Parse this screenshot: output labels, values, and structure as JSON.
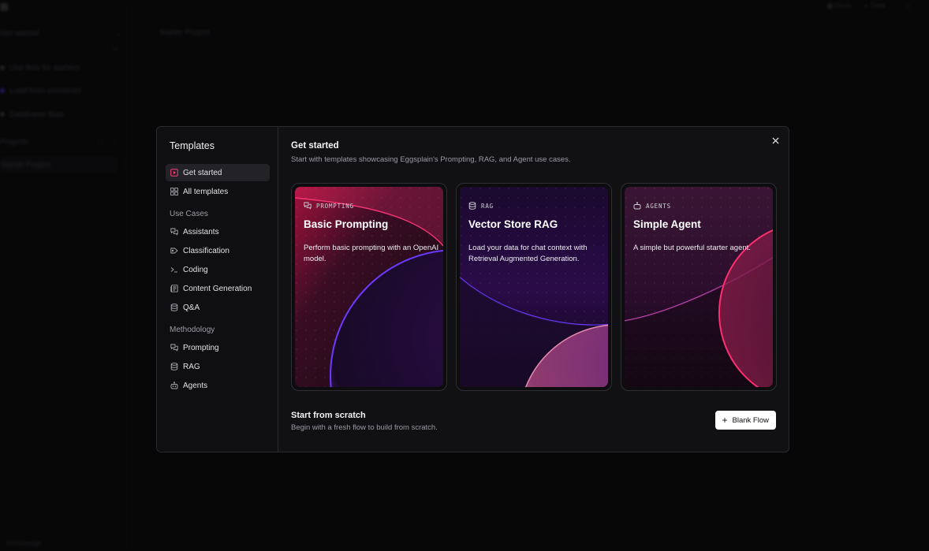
{
  "background": {
    "sidebar_section_1": "Get started",
    "sidebar_items": [
      "Use flow for starters",
      "Load from connector",
      "Dataframe Bias"
    ],
    "sidebar_section_2": "Projects",
    "sidebar_folder": "Starter Project",
    "main_title": "Starter Project",
    "top_right": [
      "Docs",
      "Dark"
    ],
    "bottom_left": "Knowledge"
  },
  "modal": {
    "nav_title": "Templates",
    "nav_primary": [
      {
        "label": "Get started",
        "icon": "play-square-icon",
        "active": true
      },
      {
        "label": "All templates",
        "icon": "layout-grid-icon",
        "active": false
      }
    ],
    "groups": [
      {
        "title": "Use Cases",
        "items": [
          {
            "label": "Assistants",
            "icon": "chat-bubbles-icon"
          },
          {
            "label": "Classification",
            "icon": "tag-icon"
          },
          {
            "label": "Coding",
            "icon": "terminal-icon"
          },
          {
            "label": "Content Generation",
            "icon": "newspaper-icon"
          },
          {
            "label": "Q&A",
            "icon": "database-icon"
          }
        ]
      },
      {
        "title": "Methodology",
        "items": [
          {
            "label": "Prompting",
            "icon": "chat-bubbles-icon"
          },
          {
            "label": "RAG",
            "icon": "database-icon"
          },
          {
            "label": "Agents",
            "icon": "bot-icon"
          }
        ]
      }
    ],
    "header_title": "Get started",
    "header_subtitle": "Start with templates showcasing Eggsplain's Prompting, RAG, and Agent use cases.",
    "cards": [
      {
        "tag": "PROMPTING",
        "title": "Basic Prompting",
        "description": "Perform basic prompting with an OpenAI model.",
        "icon": "chat-bubbles-icon"
      },
      {
        "tag": "RAG",
        "title": "Vector Store RAG",
        "description": "Load your data for chat context with Retrieval Augmented Generation.",
        "icon": "database-icon"
      },
      {
        "tag": "AGENTS",
        "title": "Simple Agent",
        "description": "A simple but powerful starter agent.",
        "icon": "bot-icon"
      }
    ],
    "scratch_title": "Start from scratch",
    "scratch_subtitle": "Begin with a fresh flow to build from scratch.",
    "blank_button": "Blank Flow",
    "colors": {
      "accent_pink": "#ff2f6e",
      "accent_purple": "#5b2ff0",
      "active_nav": "#232327"
    }
  }
}
